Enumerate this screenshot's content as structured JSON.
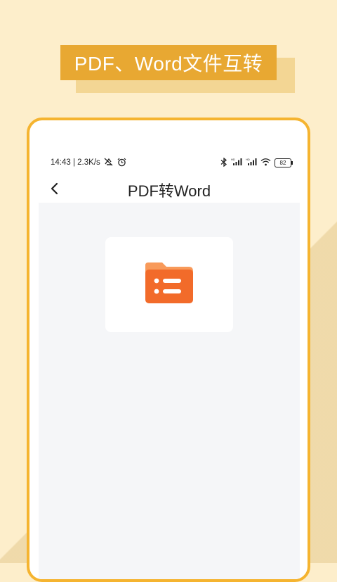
{
  "banner": {
    "title": "PDF、Word文件互转"
  },
  "statusbar": {
    "time_speed": "14:43 | 2.3K/s",
    "battery": "82",
    "icons": [
      "mute-icon",
      "alarm-icon",
      "bluetooth-icon",
      "signal-icon",
      "signal-icon",
      "wifi-icon",
      "battery-icon"
    ]
  },
  "navbar": {
    "title": "PDF转Word",
    "back_icon": "chevron-left-icon"
  },
  "file_picker": {
    "icon": "folder-list-icon",
    "colors": {
      "folder": "#f26b2a",
      "folder_tab": "#f89a5a"
    }
  },
  "colors": {
    "background": "#fdeecb",
    "banner": "#e8a832",
    "phone_border": "#f5b430",
    "content_bg": "#f5f6f8"
  }
}
